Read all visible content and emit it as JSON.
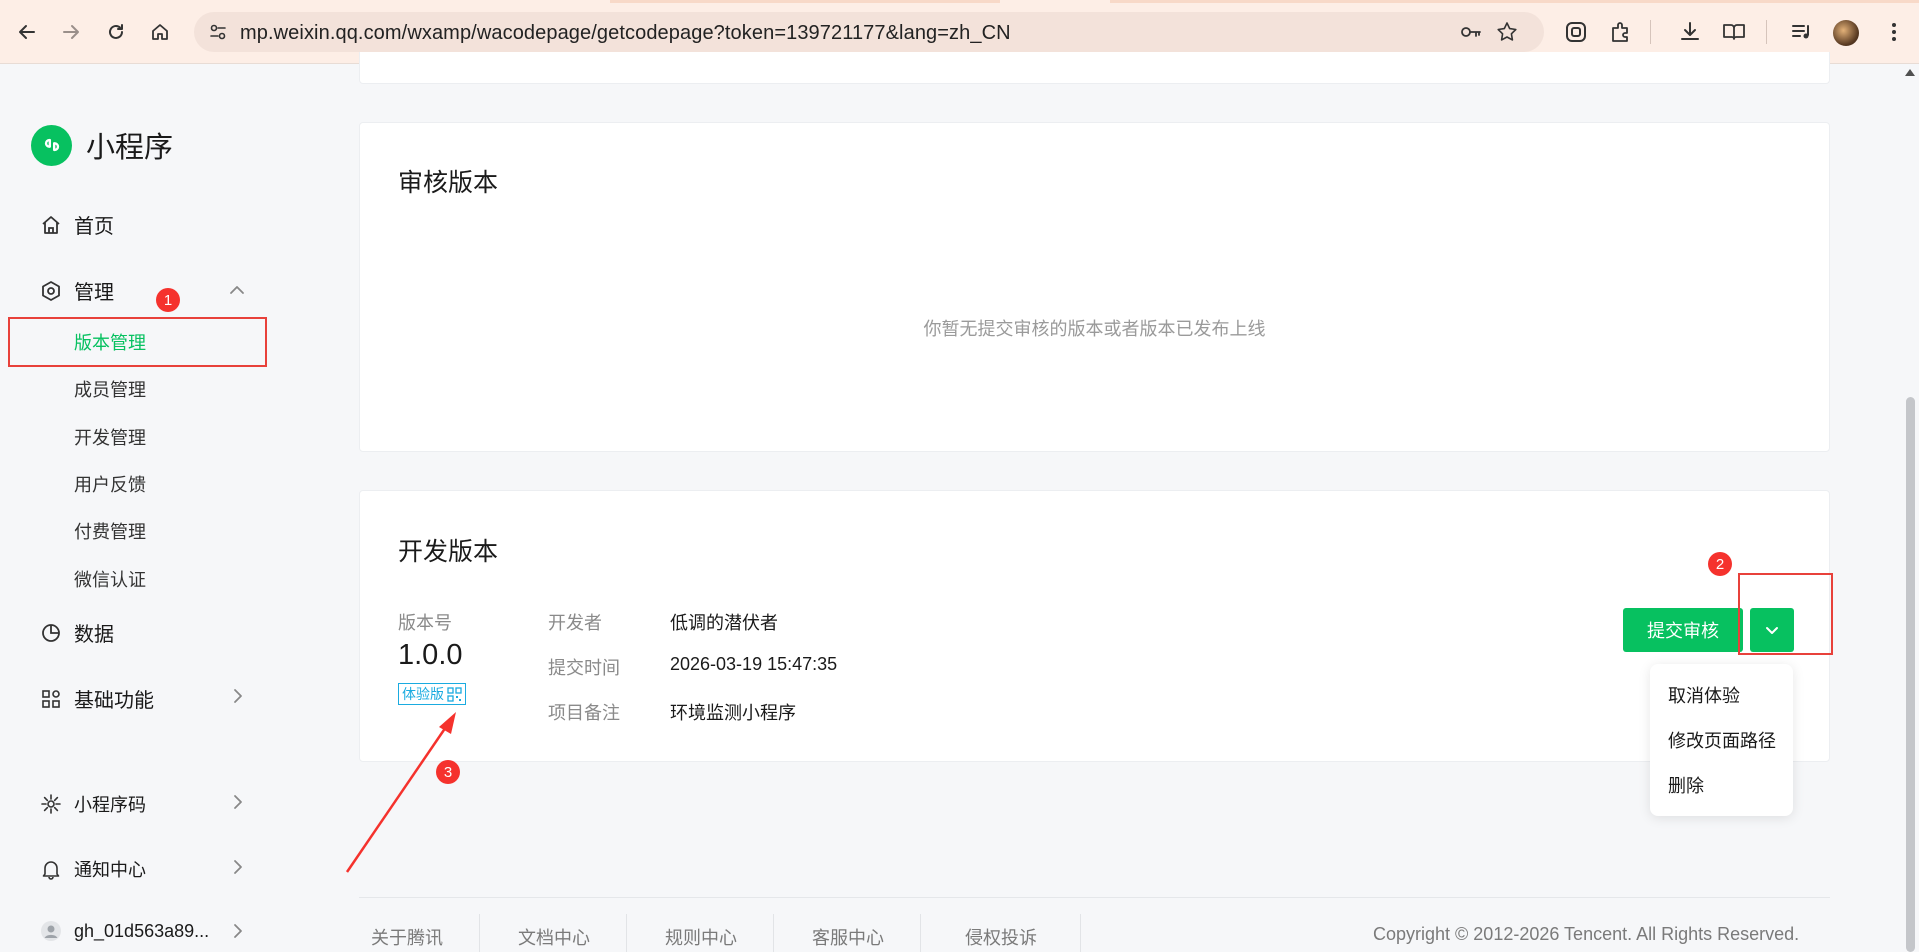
{
  "browser": {
    "url": "mp.weixin.qq.com/wxamp/wacodepage/getcodepage?token=139721177&lang=zh_CN"
  },
  "sidebar": {
    "logo_text": "小程序",
    "home": "首页",
    "manage": "管理",
    "manage_items": [
      "版本管理",
      "成员管理",
      "开发管理",
      "用户反馈",
      "付费管理",
      "微信认证"
    ],
    "data": "数据",
    "basic_features": "基础功能",
    "mini_code": "小程序码",
    "notifications": "通知中心",
    "account": "gh_01d563a89..."
  },
  "review_card": {
    "title": "审核版本",
    "empty_text": "你暂无提交审核的版本或者版本已发布上线"
  },
  "dev_card": {
    "title": "开发版本",
    "version_label": "版本号",
    "version": "1.0.0",
    "tag": "体验版",
    "developer_label": "开发者",
    "developer": "低调的潜伏者",
    "time_label": "提交时间",
    "time": "2026-03-19 15:47:35",
    "note_label": "项目备注",
    "note": "环境监测小程序",
    "submit_button": "提交审核"
  },
  "dropdown": [
    "取消体验",
    "修改页面路径",
    "删除"
  ],
  "annotations": [
    "1",
    "2",
    "3"
  ],
  "footer": {
    "links": [
      "关于腾讯",
      "文档中心",
      "规则中心",
      "客服中心",
      "侵权投诉"
    ],
    "copyright": "Copyright © 2012-2026 Tencent. All Rights Reserved."
  },
  "colors": {
    "brand": "#07c160",
    "annotation_red": "#e8413b",
    "tag_blue": "#1aabe0"
  }
}
